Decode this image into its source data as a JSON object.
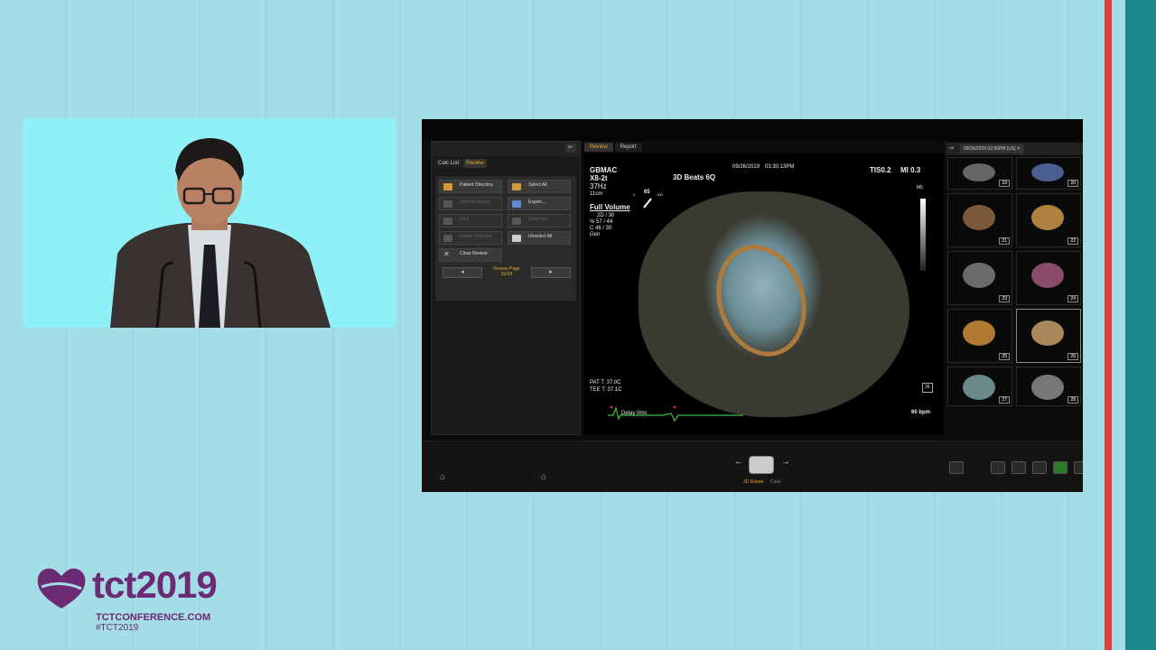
{
  "colors": {
    "brand_purple": "#6c2a75",
    "accent_orange": "#e8a62a",
    "stripe_red": "#e2403a",
    "stripe_teal": "#1b8a8c"
  },
  "logo": {
    "brand": "tct2019",
    "site": "TCTCONFERENCE.COM",
    "hashtag": "#TCT2019"
  },
  "review_panel": {
    "tabs": [
      "Calc List",
      "Review"
    ],
    "active_tab": "Review",
    "buttons": [
      {
        "label": "Patient Directory",
        "icon": "folder-icon",
        "enabled": true
      },
      {
        "label": "Select All",
        "icon": "checkbox-icon",
        "enabled": true
      },
      {
        "label": "Send to Report",
        "icon": "report-icon",
        "enabled": false
      },
      {
        "label": "Export...",
        "icon": "export-icon",
        "enabled": true
      },
      {
        "label": "Print",
        "icon": "print-icon",
        "enabled": false
      },
      {
        "label": "Select Inv...",
        "icon": "select-icon",
        "enabled": false
      },
      {
        "label": "Delete Selected",
        "icon": "delete-icon",
        "enabled": false
      },
      {
        "label": "Unselect All",
        "icon": "unselect-icon",
        "enabled": true
      },
      {
        "label": "Close Review",
        "icon": "close-icon",
        "enabled": true
      }
    ],
    "review_page": {
      "label": "Review Page",
      "value": "26/69"
    }
  },
  "image_tabs": [
    "Review",
    "Report"
  ],
  "image": {
    "site": "GBMAC",
    "probe": "X8-2t",
    "frame_rate": "37Hz",
    "depth": "11cm",
    "title": "3D Beats 6Q",
    "date": "09/26/2019",
    "time": "03:30:13PM",
    "tis": "TIS0.2",
    "mi": "MI 0.3",
    "gauge_min": "0",
    "gauge_value": "65",
    "gauge_max": "100",
    "mode": "Full Volume",
    "params": [
      "2D / 30",
      "% 57 / 44",
      "C 46 / 30",
      "Gen"
    ],
    "colorbar_label": "M5",
    "pat_temp": "PAT T: 37.0C",
    "tee_temp": "TEE T: 37.1C",
    "delay": "Delay 0ms",
    "heart_rate": "60 bpm",
    "frame_badge": "26"
  },
  "thumbnails": {
    "header_date": "09/26/2019 02:55PM [US]",
    "items": [
      "19",
      "20",
      "21",
      "22",
      "23",
      "24",
      "25",
      "26",
      "27",
      "28"
    ]
  },
  "toolbar": {
    "rotate_label": "3D Rotate",
    "clear_label": "Clear"
  }
}
